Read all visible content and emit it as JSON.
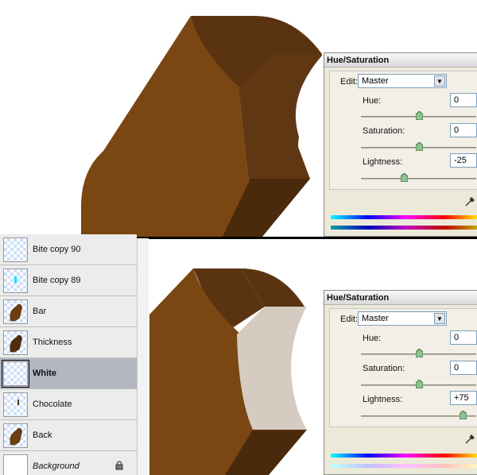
{
  "top_dialog": {
    "title": "Hue/Saturation",
    "edit_label": "Edit:",
    "edit_value": "Master",
    "hue_label": "Hue:",
    "hue_value": "0",
    "saturation_label": "Saturation:",
    "saturation_value": "0",
    "lightness_label": "Lightness:",
    "lightness_value": "-25",
    "slider_levels": {
      "hue": 0.5,
      "saturation": 0.5,
      "lightness": 0.375
    }
  },
  "bottom_dialog": {
    "title": "Hue/Saturation",
    "edit_label": "Edit:",
    "edit_value": "Master",
    "hue_label": "Hue:",
    "hue_value": "0",
    "saturation_label": "Saturation:",
    "saturation_value": "0",
    "lightness_label": "Lightness:",
    "lightness_value": "+75",
    "slider_levels": {
      "hue": 0.5,
      "saturation": 0.5,
      "lightness": 0.875
    }
  },
  "layers": [
    {
      "name": "Bite copy 90",
      "icon": "transparent-thumb"
    },
    {
      "name": "Bite copy 89",
      "icon": "cyan-dot-thumb"
    },
    {
      "name": "Bar",
      "icon": "brown-shape-thumb"
    },
    {
      "name": "Thickness",
      "icon": "dark-brown-shape-thumb"
    },
    {
      "name": "White",
      "icon": "transparent-thumb",
      "selected": true
    },
    {
      "name": "Chocolate",
      "icon": "small-brown-mark-thumb"
    },
    {
      "name": "Back",
      "icon": "brown-shape-thumb"
    },
    {
      "name": "Background",
      "icon": "white-thumb",
      "locked": true
    }
  ],
  "colors": {
    "chocolate_face": "#7a4612",
    "chocolate_side": "#5a3310",
    "chocolate_dark": "#4a2a0c",
    "bite_white_tint": "#d6cbc0",
    "selected_layer": "#b3b7c2"
  }
}
